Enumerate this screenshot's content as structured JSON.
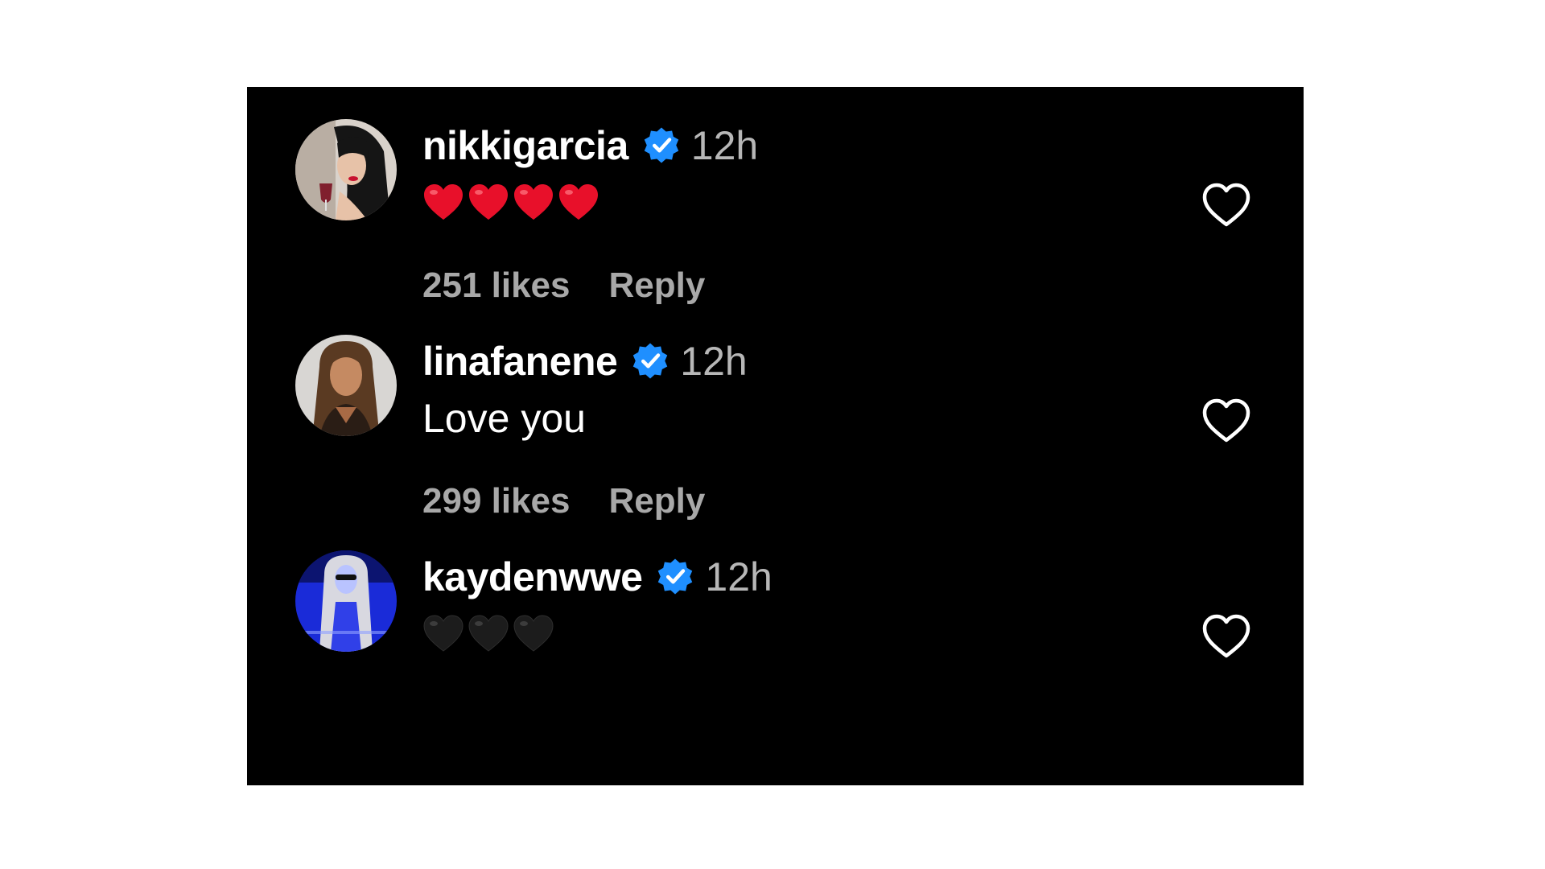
{
  "comments": [
    {
      "username": "nikkigarcia",
      "time": "12h",
      "text": "",
      "body_emoji": "red-heart",
      "body_emoji_count": 4,
      "likes": "251 likes",
      "reply": "Reply",
      "avatar_colors": {
        "bg": "#d9d2cb",
        "hair": "#151515",
        "skin": "#e7c2a8",
        "lips": "#c8102e"
      }
    },
    {
      "username": "linafanene",
      "time": "12h",
      "text": "Love you",
      "likes": "299 likes",
      "reply": "Reply",
      "avatar_colors": {
        "bg": "#d8d6d3",
        "hair": "#5a3a22",
        "skin": "#c58a62",
        "top": "#2a1d15"
      }
    },
    {
      "username": "kaydenwwe",
      "time": "12h",
      "text": "",
      "body_emoji": "black-heart",
      "body_emoji_count": 3,
      "avatar_colors": {
        "bg": "#1a2bd8",
        "hair": "#d8d8e0",
        "skin": "#b9c3ff",
        "dress": "#3040e8"
      }
    }
  ],
  "colors": {
    "panel_bg": "#000000",
    "username": "#ffffff",
    "time": "#b7b7b7",
    "meta": "#a8a8a8",
    "verified": "#1f8fff",
    "red_heart": "#e8102a",
    "black_heart": "#1c1c1c"
  },
  "icons": {
    "verified": "verified-badge-icon",
    "like": "heart-outline-icon"
  }
}
